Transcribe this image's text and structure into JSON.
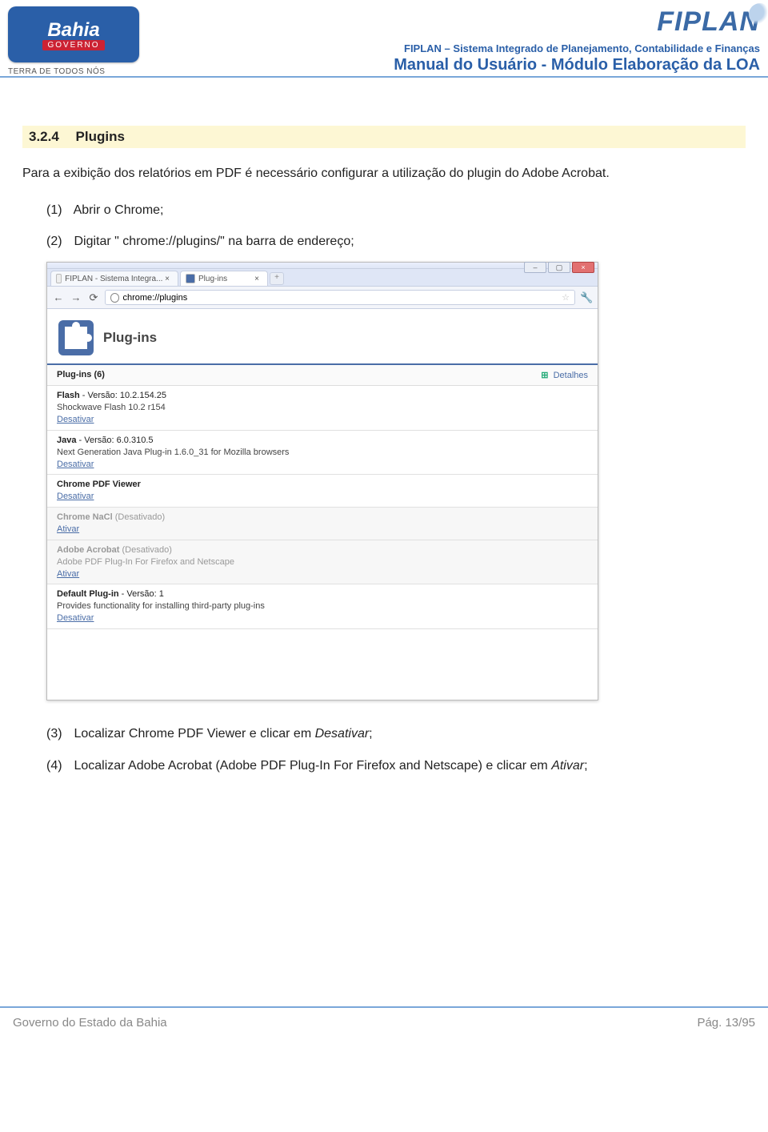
{
  "header": {
    "logo_text": "Bahia",
    "logo_gov": "GOVERNO",
    "logo_tag": "TERRA DE TODOS NÓS",
    "fiplan": "FIPLAN",
    "sub1": "FIPLAN – Sistema Integrado de Planejamento, Contabilidade e Finanças",
    "sub2": "Manual do Usuário - Módulo Elaboração da LOA"
  },
  "section": {
    "number": "3.2.4",
    "title": "Plugins",
    "para": "Para a exibição dos relatórios em PDF é necessário configurar a utilização do plugin do Adobe Acrobat.",
    "steps": [
      {
        "num": "(1)",
        "text": "Abrir o Chrome;"
      },
      {
        "num": "(2)",
        "text": "Digitar \" chrome://plugins/\" na barra de endereço;"
      },
      {
        "num": "(3)",
        "text_before": "Localizar Chrome PDF Viewer e clicar em ",
        "italic": "Desativar",
        "text_after": ";"
      },
      {
        "num": "(4)",
        "text_before": "Localizar Adobe Acrobat (Adobe PDF Plug-In For Firefox and Netscape) e clicar em ",
        "italic": "Ativar",
        "text_after": ";"
      }
    ]
  },
  "chrome": {
    "tab1": "FIPLAN - Sistema Integra... ×",
    "tab2": "Plug-ins",
    "url": "chrome://plugins",
    "banner": "Plug-ins",
    "count_label": "Plug-ins (6)",
    "details_label": "Detalhes",
    "plugins": [
      {
        "name": "Flash",
        "ver": " - Versão: 10.2.154.25",
        "desc": "Shockwave Flash 10.2 r154",
        "action": "Desativar",
        "disabled": false
      },
      {
        "name": "Java",
        "ver": " - Versão: 6.0.310.5",
        "desc": "Next Generation Java Plug-in 1.6.0_31 for Mozilla browsers",
        "action": "Desativar",
        "disabled": false
      },
      {
        "name": "Chrome PDF Viewer",
        "ver": "",
        "desc": "",
        "action": "Desativar",
        "disabled": false
      },
      {
        "name": "Chrome NaCl",
        "ver": " (Desativado)",
        "desc": "",
        "action": "Ativar",
        "disabled": true
      },
      {
        "name": "Adobe Acrobat",
        "ver": " (Desativado)",
        "desc": "Adobe PDF Plug-In For Firefox and Netscape",
        "action": "Ativar",
        "disabled": true
      },
      {
        "name": "Default Plug-in",
        "ver": " - Versão: 1",
        "desc": "Provides functionality for installing third-party plug-ins",
        "action": "Desativar",
        "disabled": false
      }
    ]
  },
  "footer": {
    "left": "Governo do Estado da Bahia",
    "right": "Pág. 13/95"
  }
}
